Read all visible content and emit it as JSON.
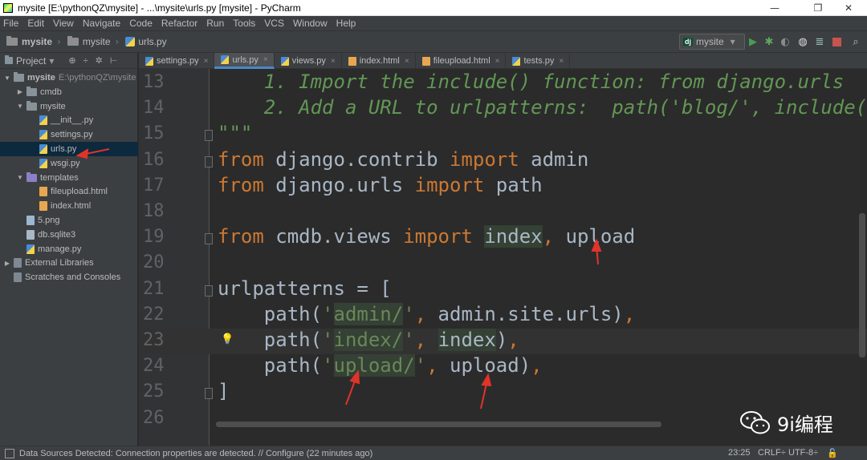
{
  "window": {
    "title": "mysite [E:\\pythonQZ\\mysite] - ...\\mysite\\urls.py [mysite] - PyCharm",
    "minimize_glyph": "—",
    "restore_glyph": "❐",
    "close_glyph": "✕"
  },
  "menu": [
    "File",
    "Edit",
    "View",
    "Navigate",
    "Code",
    "Refactor",
    "Run",
    "Tools",
    "VCS",
    "Window",
    "Help"
  ],
  "breadcrumb": [
    "mysite",
    "mysite",
    "urls.py"
  ],
  "run_config": {
    "badge": "dj",
    "label": "mysite",
    "dropdown": "▾"
  },
  "toolbar_icons": [
    "run-icon",
    "debug-icon",
    "coverage-icon",
    "profile-icon",
    "build-icon",
    "stop-icon",
    "search-icon"
  ],
  "project_panel": {
    "label": "Project",
    "dropdown": "▾",
    "icons": [
      "⊕",
      "÷",
      "✲",
      "⊢"
    ],
    "tree": [
      {
        "depth": 0,
        "arrow": "▼",
        "icon": "folder",
        "label": "mysite",
        "extra": "E:\\pythonQZ\\mysite"
      },
      {
        "depth": 1,
        "arrow": "▶",
        "icon": "folder",
        "label": "cmdb"
      },
      {
        "depth": 1,
        "arrow": "▼",
        "icon": "folder",
        "label": "mysite"
      },
      {
        "depth": 2,
        "icon": "py",
        "label": "__init__.py"
      },
      {
        "depth": 2,
        "icon": "py",
        "label": "settings.py"
      },
      {
        "depth": 2,
        "icon": "py",
        "label": "urls.py",
        "selected": true
      },
      {
        "depth": 2,
        "icon": "py",
        "label": "wsgi.py"
      },
      {
        "depth": 1,
        "arrow": "▼",
        "icon": "folder-purple",
        "label": "templates"
      },
      {
        "depth": 2,
        "icon": "html",
        "label": "fileupload.html"
      },
      {
        "depth": 2,
        "icon": "html",
        "label": "index.html"
      },
      {
        "depth": 1,
        "icon": "png",
        "label": "5.png"
      },
      {
        "depth": 1,
        "icon": "db",
        "label": "db.sqlite3"
      },
      {
        "depth": 1,
        "icon": "py",
        "label": "manage.py"
      },
      {
        "depth": 0,
        "arrow": "▶",
        "icon": "lib",
        "label": "External Libraries"
      },
      {
        "depth": 0,
        "icon": "lib",
        "label": "Scratches and Consoles"
      }
    ]
  },
  "tabs": [
    {
      "label": "settings.py",
      "active": false
    },
    {
      "label": "urls.py",
      "active": true
    },
    {
      "label": "views.py",
      "active": false
    },
    {
      "label": "index.html",
      "active": false
    },
    {
      "label": "fileupload.html",
      "active": false
    },
    {
      "label": "tests.py",
      "active": false
    }
  ],
  "tab_close": "×",
  "editor": {
    "lines": [
      {
        "n": "13",
        "segments": [
          {
            "t": "    1. Import the include() function: from django.urls ",
            "c": "doc"
          }
        ]
      },
      {
        "n": "14",
        "segments": [
          {
            "t": "    2. Add a URL to urlpatterns:  path('blog/', include(",
            "c": "doc"
          }
        ]
      },
      {
        "n": "15",
        "segments": [
          {
            "t": "\"\"\"",
            "c": "doc"
          }
        ]
      },
      {
        "n": "16",
        "segments": [
          {
            "t": "from",
            "c": "kw"
          },
          {
            "t": " django.contrib ",
            "c": ""
          },
          {
            "t": "import",
            "c": "kw"
          },
          {
            "t": " admin",
            "c": ""
          }
        ]
      },
      {
        "n": "17",
        "segments": [
          {
            "t": "from",
            "c": "kw"
          },
          {
            "t": " django.urls ",
            "c": ""
          },
          {
            "t": "import",
            "c": "kw"
          },
          {
            "t": " path",
            "c": ""
          }
        ]
      },
      {
        "n": "18",
        "segments": []
      },
      {
        "n": "19",
        "segments": [
          {
            "t": "from",
            "c": "kw"
          },
          {
            "t": " cmdb.views ",
            "c": ""
          },
          {
            "t": "import",
            "c": "kw"
          },
          {
            "t": " ",
            "c": ""
          },
          {
            "t": "index",
            "c": "hl"
          },
          {
            "t": ",",
            "c": "kw"
          },
          {
            "t": " upload",
            "c": ""
          }
        ]
      },
      {
        "n": "20",
        "segments": []
      },
      {
        "n": "21",
        "segments": [
          {
            "t": "urlpatterns = [",
            "c": ""
          }
        ]
      },
      {
        "n": "22",
        "segments": [
          {
            "t": "    path(",
            "c": ""
          },
          {
            "t": "'",
            "c": "str"
          },
          {
            "t": "admin/",
            "c": "str hl"
          },
          {
            "t": "'",
            "c": "str"
          },
          {
            "t": ",",
            "c": "kw"
          },
          {
            "t": " admin.site.urls)",
            "c": ""
          },
          {
            "t": ",",
            "c": "kw"
          }
        ]
      },
      {
        "n": "23",
        "segments": [
          {
            "t": "    path(",
            "c": ""
          },
          {
            "t": "'",
            "c": "str"
          },
          {
            "t": "index/",
            "c": "str hl"
          },
          {
            "t": "'",
            "c": "str"
          },
          {
            "t": ",",
            "c": "kw"
          },
          {
            "t": " ",
            "c": ""
          },
          {
            "t": "index",
            "c": "hl"
          },
          {
            "t": ")",
            "c": ""
          },
          {
            "t": ",",
            "c": "kw"
          }
        ]
      },
      {
        "n": "24",
        "segments": [
          {
            "t": "    path(",
            "c": ""
          },
          {
            "t": "'",
            "c": "str"
          },
          {
            "t": "upload/",
            "c": "str hl"
          },
          {
            "t": "'",
            "c": "str"
          },
          {
            "t": ",",
            "c": "kw"
          },
          {
            "t": " upload)",
            "c": ""
          },
          {
            "t": ",",
            "c": "kw"
          }
        ]
      },
      {
        "n": "25",
        "segments": [
          {
            "t": "]",
            "c": ""
          }
        ]
      },
      {
        "n": "26",
        "segments": []
      }
    ],
    "caret_line": "23",
    "bulb_line": "23",
    "fold_lines": [
      "15",
      "16",
      "19",
      "21",
      "25"
    ]
  },
  "status_bar": {
    "message": "Data Sources Detected: Connection properties are detected. // Configure (22 minutes ago)",
    "position": "23:25",
    "line_sep": "CRLF÷",
    "encoding": "UTF-8÷"
  },
  "watermark": {
    "text": "9i编程"
  },
  "colors": {
    "keyword": "#cc7832",
    "string": "#6a8759",
    "docstring": "#629755",
    "text": "#a9b7c6",
    "annotation_arrow": "#e0342a",
    "accent": "#4a88c7"
  }
}
